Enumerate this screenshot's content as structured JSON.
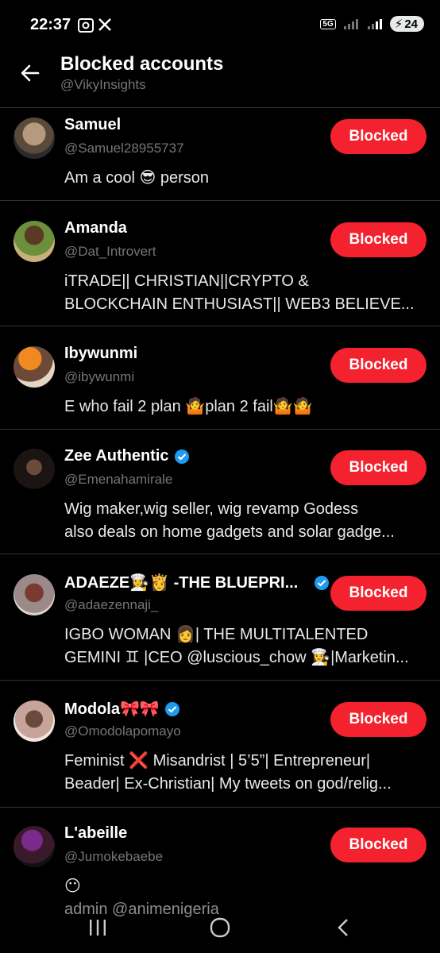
{
  "status_bar": {
    "time": "22:37",
    "network": "5G",
    "battery": "24"
  },
  "header": {
    "title": "Blocked accounts",
    "subtitle": "@VikyInsights"
  },
  "blocked_label": "Blocked",
  "accounts": [
    {
      "name": "Samuel",
      "handle": "@Samuel28955737",
      "bio_line1": "Am a cool 😎 person",
      "bio_line2": "",
      "verified": false,
      "avatar_color": "#8b7a63"
    },
    {
      "name": "Amanda",
      "handle": "@Dat_Introvert",
      "bio_line1": "iTRADE|| CHRISTIAN||CRYPTO &",
      "bio_line2": "BLOCKCHAIN ENTHUSIAST|| WEB3 BELIEVE...",
      "verified": false,
      "avatar_color": "#6b8f3a"
    },
    {
      "name": "Ibywunmi",
      "handle": "@ibywunmi",
      "bio_line1": "E who fail 2 plan 🤷plan 2 fail🤷🤷",
      "bio_line2": "",
      "verified": false,
      "avatar_color": "#c98b3a"
    },
    {
      "name": "Zee Authentic",
      "handle": "@Emenahamirale",
      "bio_line1": "Wig maker,wig seller, wig revamp Godess",
      "bio_line2": "also deals on home gadgets and solar gadge...",
      "verified": true,
      "avatar_color": "#2a2220"
    },
    {
      "name": "ADAEZE👩‍🍳👸 -THE BLUEPRI...",
      "handle": "@adaezennaji_",
      "bio_line1": "IGBO WOMAN 👩| THE MULTITALENTED",
      "bio_line2": "GEMINI ♊ |CEO @luscious_chow 👩‍🍳|Marketin...",
      "verified": true,
      "avatar_color": "#9a4a3a"
    },
    {
      "name": "Modola🎀🎀",
      "handle": "@Omodolapomayo",
      "bio_line1": "Feminist ❌ Misandrist | 5’5”| Entrepreneur|",
      "bio_line2": "Beader| Ex-Christian| My tweets on god/relig...",
      "verified": true,
      "avatar_color": "#c7a39a"
    },
    {
      "name": "L'abeille",
      "handle": "@Jumokebaebe",
      "bio_line1": "😶",
      "bio_line2": "admin @animenigeria",
      "verified": false,
      "avatar_color": "#5a2a6a"
    }
  ]
}
